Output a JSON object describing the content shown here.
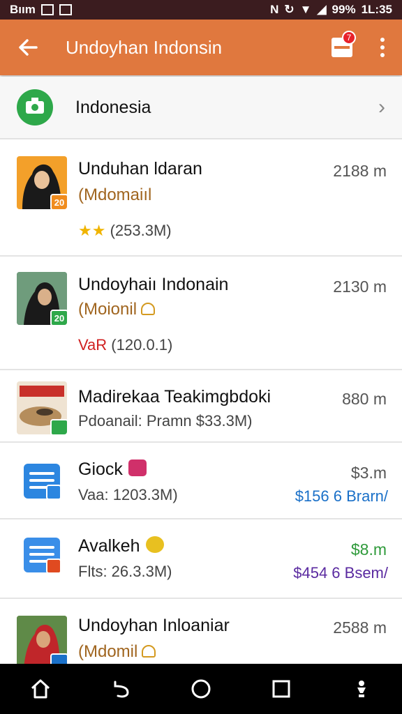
{
  "status_bar": {
    "left_text": "Bıım",
    "battery": "99%",
    "time": "1L:35"
  },
  "app_bar": {
    "title": "Undoyhan Indonsin",
    "notification_count": "7"
  },
  "country": {
    "label": "Indonesia"
  },
  "items": [
    {
      "title": "Unduhan ldaran",
      "subtitle": "(Mdomaiıl",
      "meta": "(253.3M)",
      "meta_prefix": "★★",
      "size": "2188 m",
      "badge": "20",
      "badge_color": "#f08c1e"
    },
    {
      "title": "Undoyhaiı Indonain",
      "subtitle": "(Moionil",
      "meta": "(120.0.1)",
      "meta_prefix": "VaR",
      "size": "2130 m",
      "badge": "20",
      "badge_color": "#2ea84a"
    },
    {
      "title": "Madirekaa Teakimgbdoki",
      "meta": "Pdoanail: Pramn $33.3M)",
      "size": "880 m",
      "badge_color": "#2ea84a"
    },
    {
      "title": "Giock",
      "meta": "Vaa: 1203.3M)",
      "size": "$3.m",
      "price": "$156 6 Brarn/",
      "price_color": "#1a70c8",
      "icon": "server-icon"
    },
    {
      "title": "Avalkeh",
      "meta": "Flts: 26.3.3M)",
      "size": "$8.m",
      "size_color": "#2e9a3a",
      "price": "$454 6 Bsem/",
      "price_color": "#5a2aa0",
      "icon": "document-icon"
    },
    {
      "title": "Undoyhan Inloaniar",
      "subtitle": "(Mdomil",
      "size": "2588 m",
      "badge_color": "#1a70c8"
    }
  ]
}
